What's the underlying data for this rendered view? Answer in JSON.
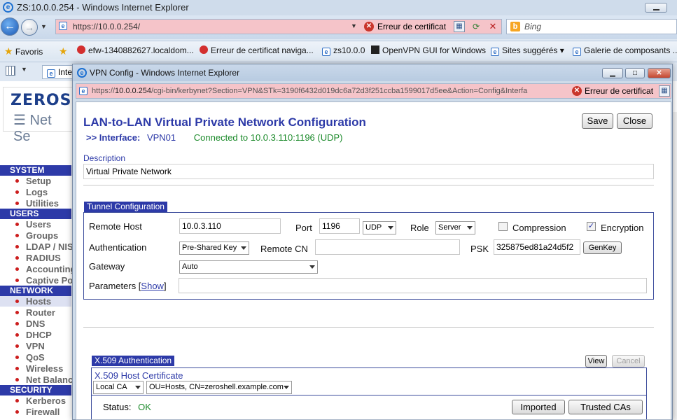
{
  "main_window": {
    "title": "ZS:10.0.0.254 - Windows Internet Explorer",
    "address": "https://10.0.0.254/",
    "cert_error": "Erreur de certificat",
    "search_placeholder": "Bing"
  },
  "favorites": {
    "label": "Favoris",
    "items": [
      "efw-1340882627.localdom...",
      "Erreur de certificat  naviga...",
      "zs10.0.0",
      "OpenVPN GUI for Windows",
      "Sites suggérés ▾",
      "Galerie de composants ..."
    ]
  },
  "tab": {
    "label": "Interne"
  },
  "bg_page": {
    "logo_top": "ZEROSH",
    "logo_bottom": "Net Se",
    "sidebar": [
      {
        "section": "SYSTEM",
        "items": [
          "Setup",
          "Logs",
          "Utilities"
        ]
      },
      {
        "section": "USERS",
        "items": [
          "Users",
          "Groups",
          "LDAP / NIS",
          "RADIUS",
          "Accounting",
          "Captive Portal"
        ]
      },
      {
        "section": "NETWORK",
        "items": [
          "Hosts",
          "Router",
          "DNS",
          "DHCP",
          "VPN",
          "QoS",
          "Wireless",
          "Net Balancer"
        ]
      },
      {
        "section": "SECURITY",
        "items": [
          "Kerberos",
          "Firewall"
        ]
      }
    ]
  },
  "popup": {
    "title": "VPN Config - Windows Internet Explorer",
    "address_prefix": "https://",
    "address_host": "10.0.0.254",
    "address_rest": "/cgi-bin/kerbynet?Section=VPN&STk=3190f6432d019dc6a72d3f251ccba1599017d5ee&Action=Config&Interfa",
    "cert_error": "Erreur de certificat"
  },
  "config": {
    "title": "LAN-to-LAN Virtual Private Network Configuration",
    "interface_label": ">> Interface:",
    "interface_value": "VPN01",
    "connection_status": "Connected to 10.0.3.110:1196 (UDP)",
    "save_label": "Save",
    "close_label": "Close",
    "description_label": "Description",
    "description_value": "Virtual Private Network",
    "tunnel_legend": "Tunnel Configuration",
    "remote_host_label": "Remote Host",
    "remote_host_value": "10.0.3.110",
    "port_label": "Port",
    "port_value": "1196",
    "protocol_value": "UDP",
    "role_label": "Role",
    "role_value": "Server",
    "compression_label": "Compression",
    "compression_checked": false,
    "encryption_label": "Encryption",
    "encryption_checked": true,
    "authentication_label": "Authentication",
    "authentication_value": "Pre-Shared Key",
    "remote_cn_label": "Remote CN",
    "remote_cn_value": "",
    "psk_label": "PSK",
    "psk_value": "325875ed81a24d5f2",
    "genkey_label": "GenKey",
    "gateway_label": "Gateway",
    "gateway_value": "Auto",
    "parameters_label": "Parameters [",
    "parameters_show": "Show",
    "parameters_close_bracket": "]",
    "parameters_value": "",
    "x509_legend": "X.509 Authentication",
    "view_label": "View",
    "cancel_label": "Cancel",
    "host_cert_label": "X.509 Host Certificate",
    "ca_value": "Local CA",
    "cert_value": "OU=Hosts, CN=zeroshell.example.com",
    "status_label": "Status:",
    "status_value": "OK",
    "imported_label": "Imported",
    "trusted_label": "Trusted CAs"
  },
  "colors": {
    "accent": "#2d3aa8",
    "connected": "#1b8a2a",
    "cert_error_bg": "#f5c4c9"
  }
}
